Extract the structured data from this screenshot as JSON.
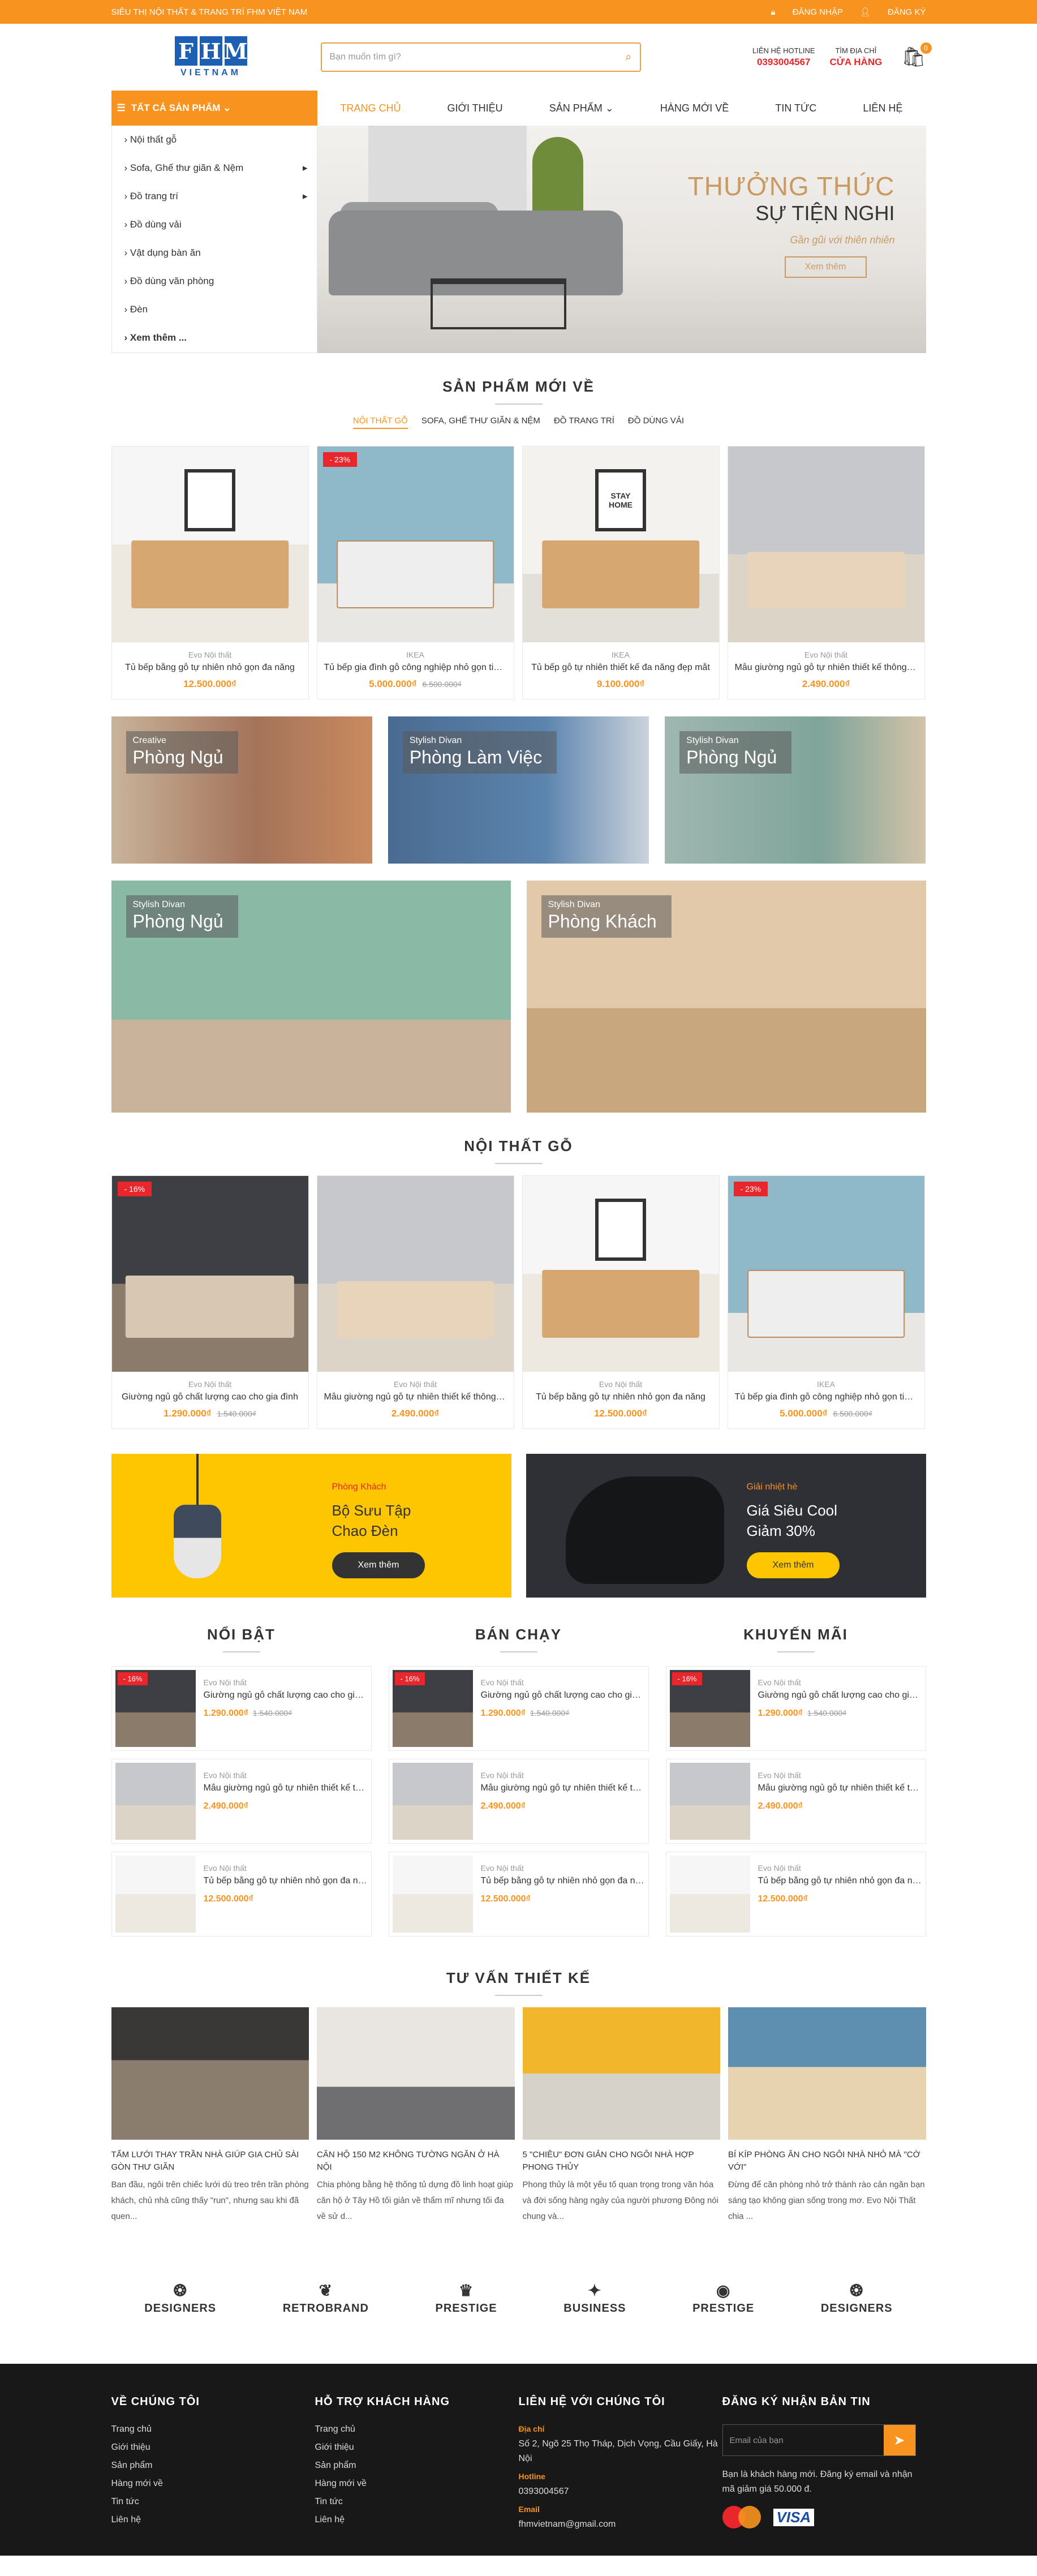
{
  "topbar": {
    "slogan": "SIÊU THỊ NỘI THẤT & TRANG TRÍ FHM VIỆT NAM",
    "login": "ĐĂNG NHẬP",
    "register": "ĐĂNG KÝ"
  },
  "logo": {
    "letters": [
      "F",
      "H",
      "M"
    ],
    "sub": "VIETNAM"
  },
  "search": {
    "placeholder": "Bạn muốn tìm gì?"
  },
  "contact": {
    "hotline_label": "LIÊN HỆ HOTLINE",
    "hotline": "0393004567",
    "store_label": "TÌM ĐỊA CHỈ",
    "store": "CỬA HÀNG"
  },
  "cart": {
    "count": "0"
  },
  "nav": {
    "all_categories": "TẤT CẢ SẢN PHẨM",
    "menu": [
      "TRANG CHỦ",
      "GIỚI THIỆU",
      "SẢN PHẨM",
      "HÀNG MỚI VỀ",
      "TIN TỨC",
      "LIÊN HỆ"
    ]
  },
  "categories": [
    "Nội thất gỗ",
    "Sofa, Ghế thư giãn & Nệm",
    "Đồ trang trí",
    "Đồ dùng vải",
    "Vật dụng bàn ăn",
    "Đồ dùng văn phòng",
    "Đèn",
    "Xem thêm ..."
  ],
  "hero": {
    "line1": "THƯỞNG THỨC",
    "line2": "SỰ TIỆN NGHI",
    "line3": "Gần gũi với thiên nhiên",
    "button": "Xem thêm"
  },
  "new_products": {
    "title": "SẢN PHẨM MỚI VỀ",
    "tabs": [
      "NỘI THẤT GỖ",
      "SOFA, GHẾ THƯ GIÃN & NỆM",
      "ĐỒ TRANG TRÍ",
      "ĐỒ DÙNG VẢI"
    ],
    "items": [
      {
        "brand": "Evo Nội thất",
        "name": "Tủ bếp bằng gỗ tự nhiên nhỏ gọn đa năng",
        "price": "12.500.000₫",
        "old": "",
        "sale": ""
      },
      {
        "brand": "IKEA",
        "name": "Tủ bếp gia đình gỗ công nghiệp nhỏ gọn tiện lợi",
        "price": "5.000.000₫",
        "old": "6.500.000₫",
        "sale": "- 23%"
      },
      {
        "brand": "IKEA",
        "name": "Tủ bếp gỗ tự nhiên thiết kế đa năng đẹp mắt",
        "price": "9.100.000₫",
        "old": "",
        "sale": ""
      },
      {
        "brand": "Evo Nội thất",
        "name": "Mẫu giường ngủ gỗ tự nhiên thiết kế thông minh",
        "price": "2.490.000₫",
        "old": "",
        "sale": ""
      }
    ]
  },
  "room_banners": [
    {
      "small": "Creative",
      "big": "Phòng Ngủ"
    },
    {
      "small": "Stylish Divan",
      "big": "Phòng Làm Việc"
    },
    {
      "small": "Stylish Divan",
      "big": "Phòng Ngủ"
    },
    {
      "small": "Stylish Divan",
      "big": "Phòng Ngủ"
    },
    {
      "small": "Stylish Divan",
      "big": "Phòng Khách"
    }
  ],
  "wood": {
    "title": "NỘI THẤT GỖ",
    "items": [
      {
        "brand": "Evo Nội thất",
        "name": "Giường ngủ gỗ chất lượng cao cho gia đình",
        "price": "1.290.000₫",
        "old": "1.540.000₫",
        "sale": "- 16%"
      },
      {
        "brand": "Evo Nội thất",
        "name": "Mẫu giường ngủ gỗ tự nhiên thiết kế thông minh",
        "price": "2.490.000₫",
        "old": "",
        "sale": ""
      },
      {
        "brand": "Evo Nội thất",
        "name": "Tủ bếp bằng gỗ tự nhiên nhỏ gọn đa năng",
        "price": "12.500.000₫",
        "old": "",
        "sale": ""
      },
      {
        "brand": "IKEA",
        "name": "Tủ bếp gia đình gỗ công nghiệp nhỏ gọn tiện lợi",
        "price": "5.000.000₫",
        "old": "6.500.000₫",
        "sale": "- 23%"
      }
    ]
  },
  "promos": [
    {
      "small": "Phòng Khách",
      "big1": "Bộ Sưu Tập",
      "big2": "Chao Đèn",
      "button": "Xem thêm"
    },
    {
      "small": "Giải nhiệt hè",
      "big1": "Giá Siêu Cool",
      "big2": "Giảm 30%",
      "button": "Xem thêm"
    }
  ],
  "lists": [
    {
      "title": "NỔI BẬT",
      "items": [
        {
          "brand": "Evo Nội thất",
          "name": "Giường ngủ gỗ chất lượng cao cho gia đình",
          "price": "1.290.000₫",
          "old": "1.540.000₫",
          "sale": "- 16%"
        },
        {
          "brand": "Evo Nội thất",
          "name": "Mẫu giường ngủ gỗ tự nhiên thiết kế thông minh",
          "price": "2.490.000₫",
          "old": "",
          "sale": ""
        },
        {
          "brand": "Evo Nội thất",
          "name": "Tủ bếp bằng gỗ tự nhiên nhỏ gọn đa năng",
          "price": "12.500.000₫",
          "old": "",
          "sale": ""
        }
      ]
    },
    {
      "title": "BÁN CHẠY",
      "items": [
        {
          "brand": "Evo Nội thất",
          "name": "Giường ngủ gỗ chất lượng cao cho gia đình",
          "price": "1.290.000₫",
          "old": "1.540.000₫",
          "sale": "- 16%"
        },
        {
          "brand": "Evo Nội thất",
          "name": "Mẫu giường ngủ gỗ tự nhiên thiết kế thông minh",
          "price": "2.490.000₫",
          "old": "",
          "sale": ""
        },
        {
          "brand": "Evo Nội thất",
          "name": "Tủ bếp bằng gỗ tự nhiên nhỏ gọn đa năng",
          "price": "12.500.000₫",
          "old": "",
          "sale": ""
        }
      ]
    },
    {
      "title": "KHUYẾN MÃI",
      "items": [
        {
          "brand": "Evo Nội thất",
          "name": "Giường ngủ gỗ chất lượng cao cho gia đình",
          "price": "1.290.000₫",
          "old": "1.540.000₫",
          "sale": "- 16%"
        },
        {
          "brand": "Evo Nội thất",
          "name": "Mẫu giường ngủ gỗ tự nhiên thiết kế thông minh",
          "price": "2.490.000₫",
          "old": "",
          "sale": ""
        },
        {
          "brand": "Evo Nội thất",
          "name": "Tủ bếp bằng gỗ tự nhiên nhỏ gọn đa năng",
          "price": "12.500.000₫",
          "old": "",
          "sale": ""
        }
      ]
    }
  ],
  "news": {
    "title": "TƯ VẤN THIẾT KẾ",
    "items": [
      {
        "title": "TẤM LƯỚI THAY TRẦN NHÀ GIÚP GIA CHỦ SÀI GÒN THƯ GIÃN",
        "desc": "Ban đầu, ngôi trên chiếc lưới dù treo trên trần phòng khách, chủ nhà cũng thấy \"run\", nhưng sau khi đã quen..."
      },
      {
        "title": "CĂN HỘ 150 M2 KHÔNG TƯỜNG NGĂN Ở HÀ NỘI",
        "desc": "Chia phòng bằng hệ thống tủ dựng đồ linh hoạt giúp căn hộ ở Tây Hồ tối giản về thẩm mĩ nhưng tối đa về sử d..."
      },
      {
        "title": "5 \"CHIÊU\" ĐƠN GIẢN CHO NGÔI NHÀ HỢP PHONG THỦY",
        "desc": "Phong thủy là một yếu tố quan trọng trong văn hóa và đời sống hàng ngày của người phương Đông nói chung và..."
      },
      {
        "title": "BÍ KÍP PHÒNG ĂN CHO NGÔI NHÀ NHỎ MÀ \"CỜ VỚI\"",
        "desc": "Đừng để căn phòng nhỏ trở thành rào cản ngăn bạn sáng tạo không gian sống trong mơ. Evo Nội Thất chia ..."
      }
    ]
  },
  "brands": [
    "DESIGNERS",
    "RETROBRAND",
    "PRESTIGE",
    "BUSINESS",
    "PRESTIGE",
    "DESIGNERS"
  ],
  "footer": {
    "about_title": "VỀ CHÚNG TÔI",
    "about_links": [
      "Trang chủ",
      "Giới thiệu",
      "Sản phẩm",
      "Hàng mới về",
      "Tin tức",
      "Liên hệ"
    ],
    "support_title": "HỖ TRỢ KHÁCH HÀNG",
    "support_links": [
      "Trang chủ",
      "Giới thiệu",
      "Sản phẩm",
      "Hàng mới về",
      "Tin tức",
      "Liên hệ"
    ],
    "contact_title": "LIÊN HỆ VỚI CHÚNG TÔI",
    "address_label": "Địa chỉ",
    "address": "Số 2, Ngõ 25 Thọ Tháp, Dịch Vọng, Cầu Giấy, Hà Nội",
    "hotline_label": "Hotline",
    "hotline": "0393004567",
    "email_label": "Email",
    "email": "fhmvietnam@gmail.com",
    "newsletter_title": "ĐĂNG KÝ NHẬN BẢN TIN",
    "newsletter_placeholder": "Email của bạn",
    "newsletter_text": "Bạn là khách hàng mới. Đăng ký email và nhận mã giảm giá 50.000 đ.",
    "visa": "VISA"
  }
}
